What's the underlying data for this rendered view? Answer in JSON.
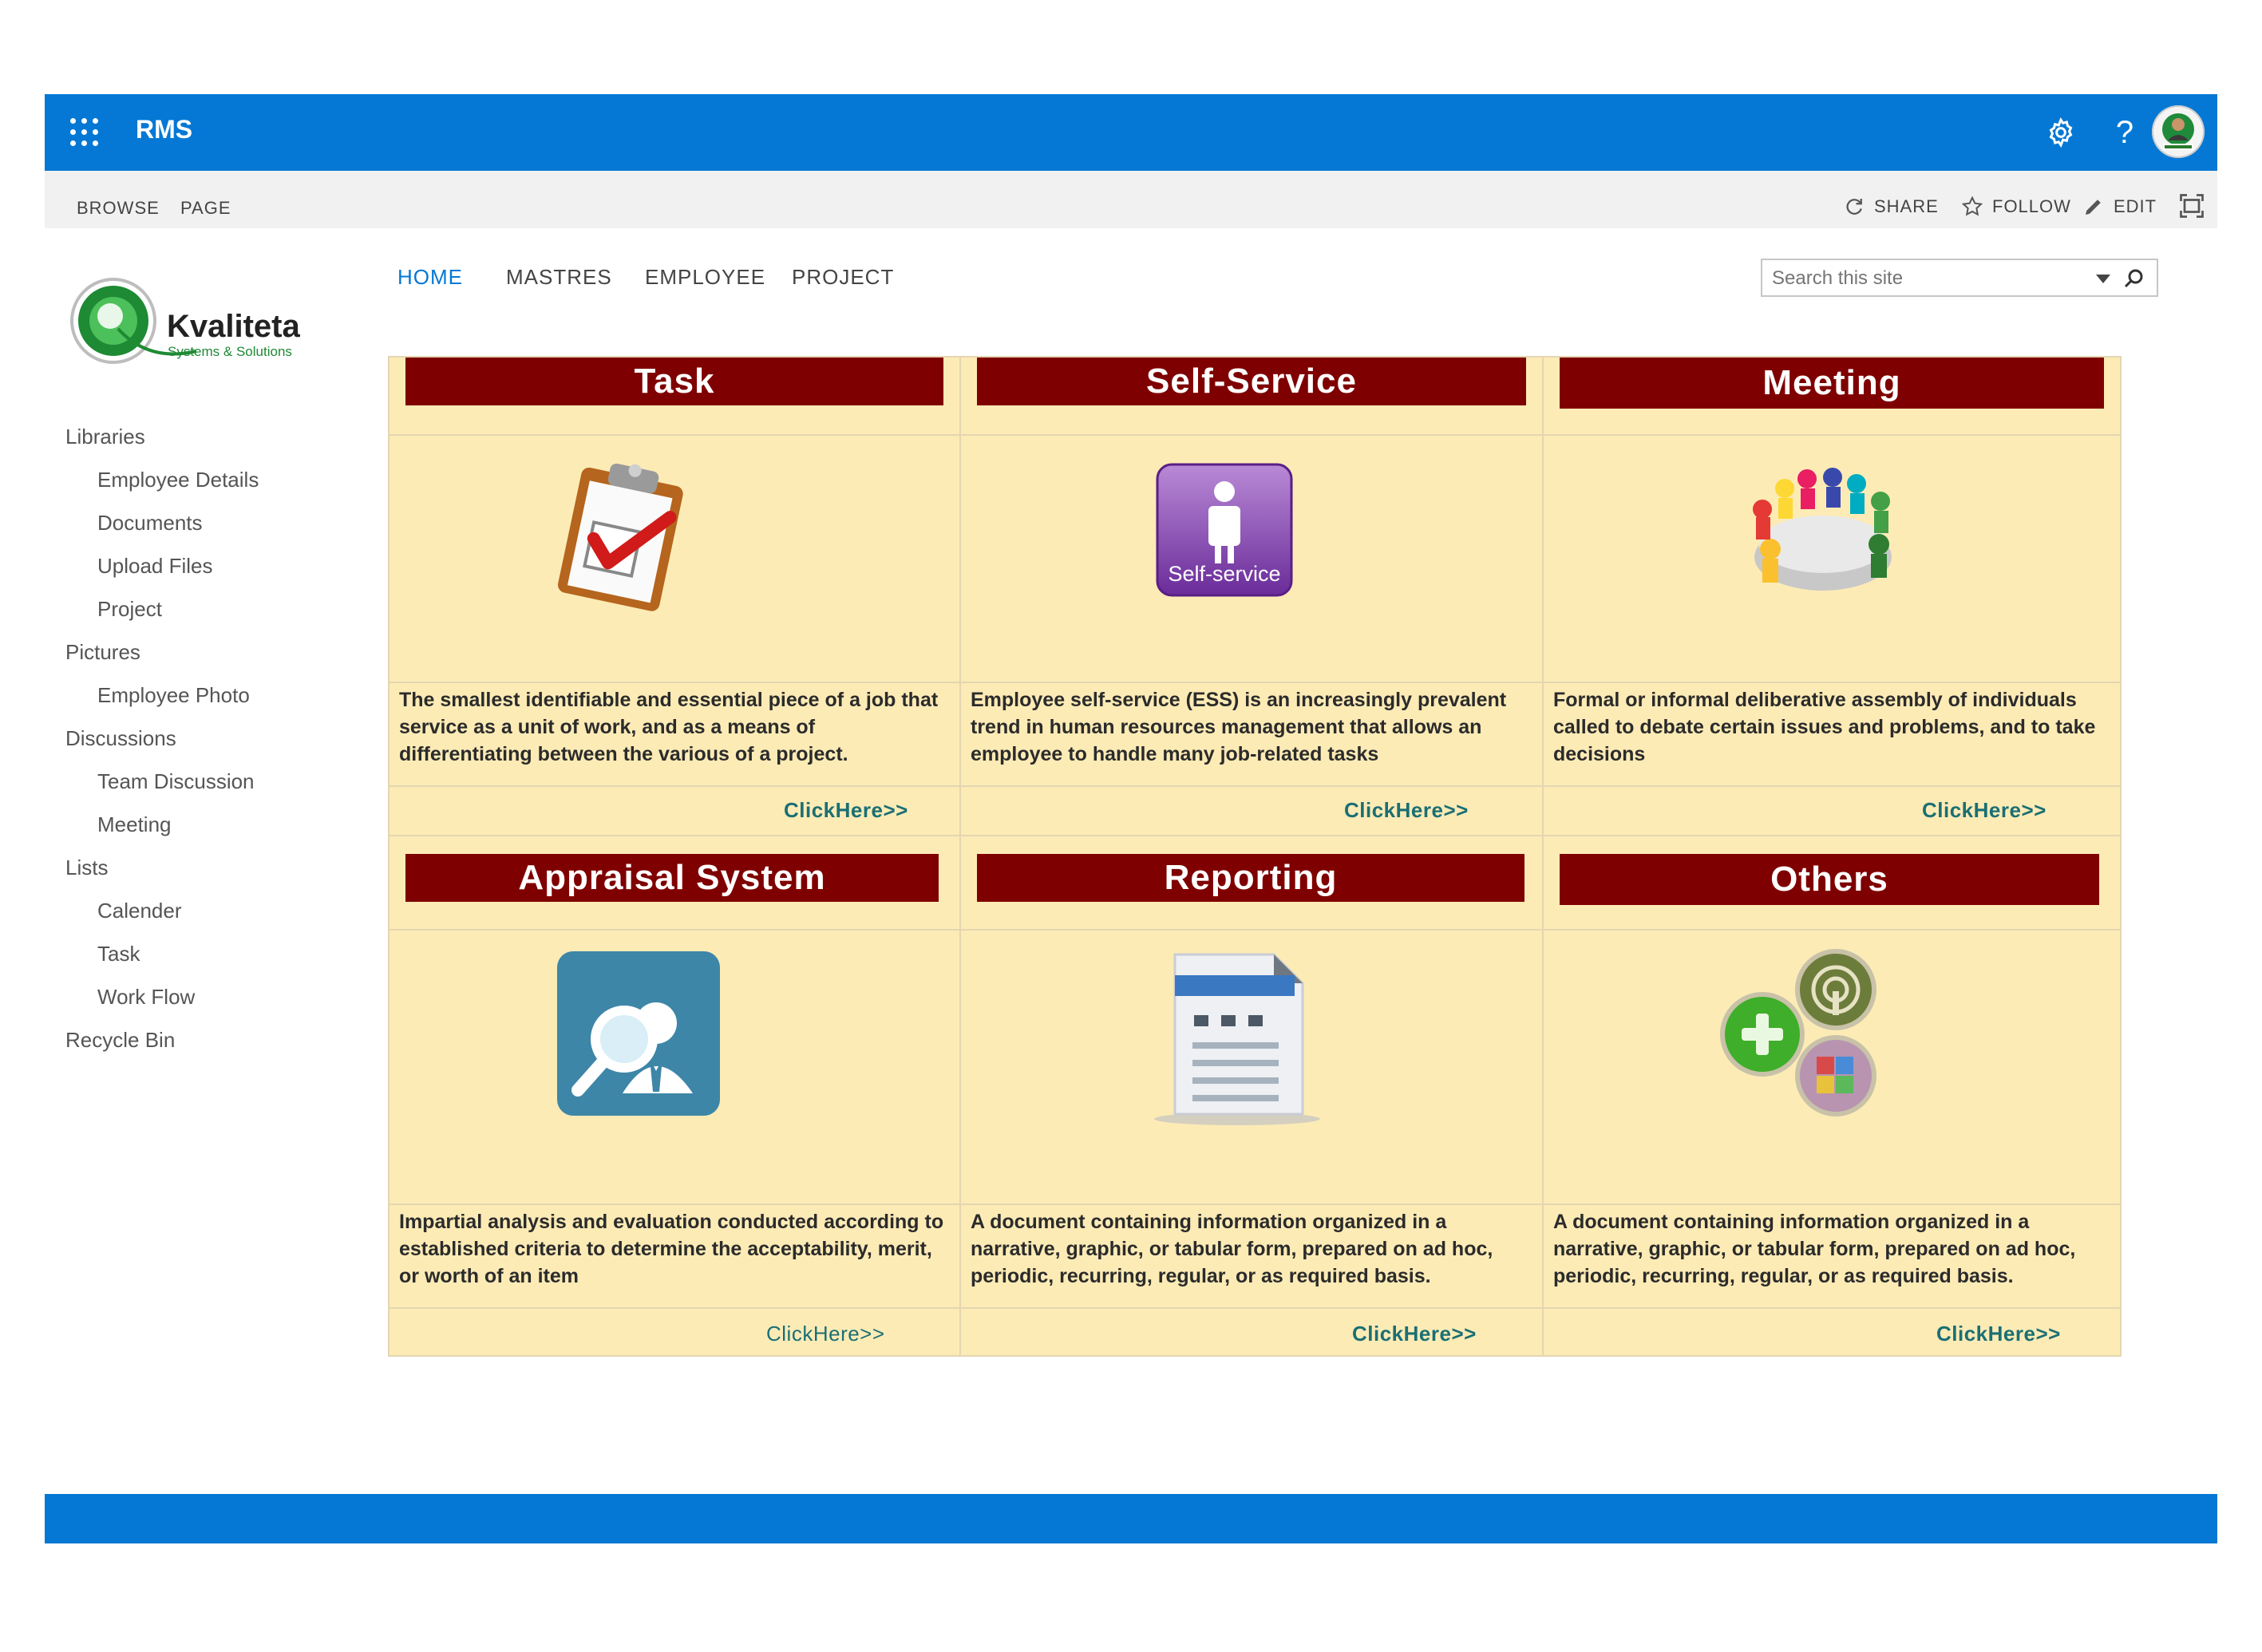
{
  "suite": {
    "app_title": "RMS"
  },
  "ribbon": {
    "tabs": [
      "BROWSE",
      "PAGE"
    ],
    "actions": {
      "share": "SHARE",
      "follow": "FOLLOW",
      "edit": "EDIT"
    }
  },
  "logo": {
    "name": "Kvaliteta",
    "tagline": "Systems & Solutions"
  },
  "leftnav": {
    "items": [
      {
        "label": "Libraries",
        "level": 0
      },
      {
        "label": "Employee Details",
        "level": 1
      },
      {
        "label": "Documents",
        "level": 1
      },
      {
        "label": "Upload Files",
        "level": 1
      },
      {
        "label": "Project",
        "level": 1
      },
      {
        "label": "Pictures",
        "level": 0
      },
      {
        "label": "Employee Photo",
        "level": 1
      },
      {
        "label": "Discussions",
        "level": 0
      },
      {
        "label": "Team Discussion",
        "level": 1
      },
      {
        "label": "Meeting",
        "level": 1
      },
      {
        "label": "Lists",
        "level": 0
      },
      {
        "label": "Calender",
        "level": 1
      },
      {
        "label": "Task",
        "level": 1
      },
      {
        "label": "Work Flow",
        "level": 1
      },
      {
        "label": "Recycle Bin",
        "level": 0
      }
    ]
  },
  "topnav": {
    "items": [
      "HOME",
      "MASTRES",
      "EMPLOYEE",
      "PROJECT"
    ],
    "active": "HOME"
  },
  "search": {
    "placeholder": "Search this site"
  },
  "tiles": [
    {
      "title": "Task",
      "description": "The smallest identifiable and essential piece of a job that service as a unit of work, and as a means of differentiating between the various  of a project.",
      "link": "ClickHere>>",
      "icon": "clipboard-check-icon"
    },
    {
      "title": "Self-Service",
      "description": "Employee self-service (ESS) is an increasingly prevalent trend in human resources management that allows an employee to handle many job-related tasks",
      "link": "ClickHere>>",
      "icon": "self-service-icon",
      "icon_text": "Self-service"
    },
    {
      "title": "Meeting",
      "description": "Formal or informal deliberative assembly of individuals called to debate certain issues and problems, and to take decisions",
      "link": "ClickHere>>",
      "icon": "meeting-table-icon"
    },
    {
      "title": "Appraisal System",
      "description": "Impartial analysis and evaluation conducted according to established criteria to determine the acceptability, merit, or worth of an item",
      "link": "ClickHere>>",
      "icon": "appraisal-magnifier-icon"
    },
    {
      "title": "Reporting",
      "description": "A document containing information organized in a narrative, graphic, or tabular form, prepared on ad hoc, periodic, recurring, regular, or as required basis.",
      "link": "ClickHere>>",
      "icon": "report-document-icon"
    },
    {
      "title": "Others",
      "description": "A document containing information organized in a narrative, graphic, or tabular form, prepared on ad hoc, periodic, recurring, regular, or as required basis.",
      "link": "ClickHere>>",
      "icon": "others-circles-icon"
    }
  ],
  "colors": {
    "suite_blue": "#0478d4",
    "tile_bg": "#fdebb6",
    "header_red": "#7f0000",
    "link_teal": "#1a6f74"
  }
}
